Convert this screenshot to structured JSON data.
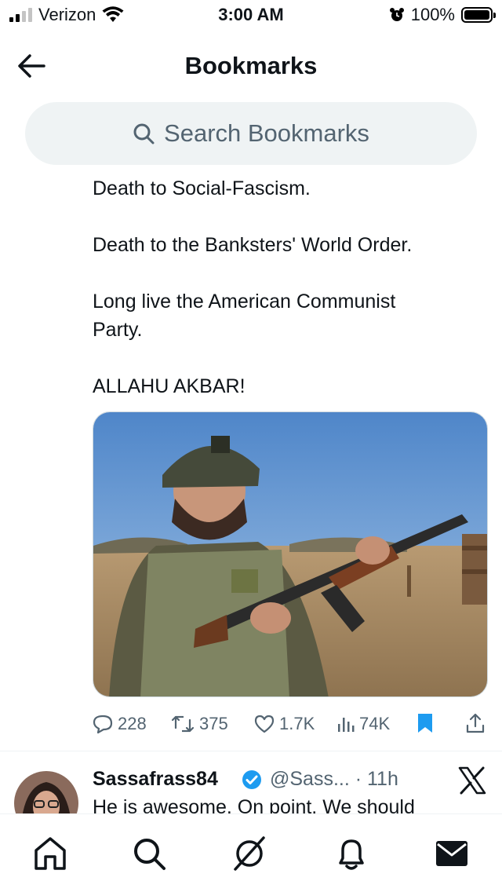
{
  "status": {
    "carrier": "Verizon",
    "time": "3:00 AM",
    "battery": "100%",
    "signal_bars": 2,
    "icons": [
      "signal-icon",
      "wifi-icon",
      "alarm-icon",
      "battery-icon"
    ]
  },
  "header": {
    "title": "Bookmarks",
    "back_icon": "arrow-left-icon"
  },
  "search": {
    "placeholder": "Search Bookmarks",
    "icon": "search-icon"
  },
  "tweet": {
    "lines": [
      "Death to Social-Fascism.",
      "Death to the Banksters' World Order.",
      "Long live the American Communist Party.",
      "ALLAHU AKBAR!"
    ],
    "line_partial": "Death to Social-Fascism.",
    "line_1": "Death to the Banksters' World Order.",
    "line_2a": "Long live the American Communist",
    "line_2b": "Party.",
    "line_3": "ALLAHU AKBAR!",
    "media": "photo of bearded man in helmet holding rifle outdoors",
    "actions": {
      "replies": "228",
      "reposts": "375",
      "likes": "1.7K",
      "views": "74K",
      "bookmarked": true
    }
  },
  "reply": {
    "name": "Sassafrass84",
    "handle_time": "@Sass... · 11h",
    "text": "He is awesome. On point. We should",
    "verified": true
  },
  "tabbar": {
    "items": [
      "home-icon",
      "search-icon",
      "grok-icon",
      "notifications-icon",
      "messages-icon"
    ]
  },
  "colors": {
    "accent": "#1d9bf0",
    "text": "#0f1419",
    "secondary": "#536471",
    "search_bg": "#eff3f4"
  }
}
